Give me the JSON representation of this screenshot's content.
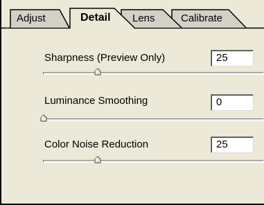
{
  "tabs": [
    {
      "label": "Adjust",
      "active": false
    },
    {
      "label": "Detail",
      "active": true
    },
    {
      "label": "Lens",
      "active": false
    },
    {
      "label": "Calibrate",
      "active": false
    }
  ],
  "controls": [
    {
      "label": "Sharpness  (Preview Only)",
      "value": "25",
      "slider_fraction": 0.25
    },
    {
      "label": "Luminance Smoothing",
      "value": "0",
      "slider_fraction": 0.0
    },
    {
      "label": "Color Noise Reduction",
      "value": "25",
      "slider_fraction": 0.25
    }
  ],
  "icons": {
    "slider_thumb": "slider-thumb-icon"
  }
}
